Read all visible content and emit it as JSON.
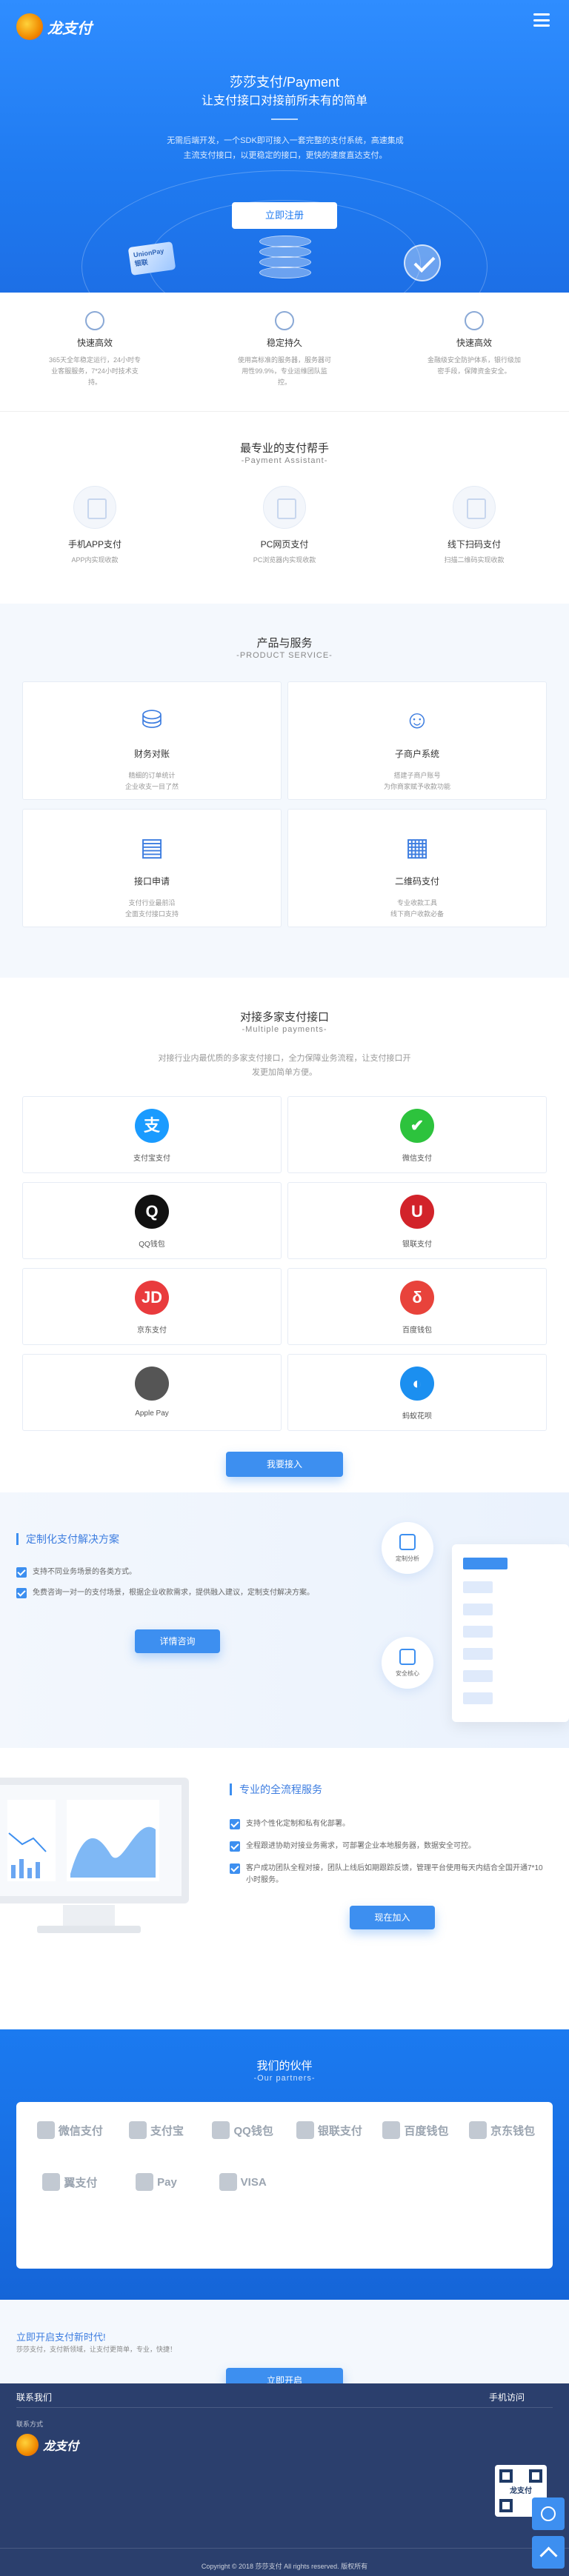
{
  "header": {
    "logo_text": "龙支付",
    "hero_title": "莎莎支付/Payment",
    "hero_subtitle": "让支付接口对接前所未有的简单",
    "hero_desc": "无需后端开发，一个SDK即可接入一套完整的支付系统，高速集成主流支付接口，以更稳定的接口，更快的速度直达支付。",
    "register_button": "立即注册",
    "card_text": "UnionPay 银联"
  },
  "features": [
    {
      "title": "快速高效",
      "desc": "365天全年稳定运行，24小时专业客服服务，7*24小时技术支持。"
    },
    {
      "title": "稳定持久",
      "desc": "使用高标准的服务器，服务器可用性99.9%，专业运维团队监控。"
    },
    {
      "title": "快速高效",
      "desc": "金融级安全防护体系，银行级加密手段，保障资金安全。"
    }
  ],
  "assistant": {
    "title": "最专业的支付帮手",
    "subtitle": "-Payment Assistant-",
    "items": [
      {
        "title": "手机APP支付",
        "desc": "APP内实现收款"
      },
      {
        "title": "PC网页支付",
        "desc": "PC浏览器内实现收款"
      },
      {
        "title": "线下扫码支付",
        "desc": "扫描二维码实现收款"
      }
    ]
  },
  "products": {
    "title": "产品与服务",
    "subtitle": "-PRODUCT SERVICE-",
    "items": [
      {
        "title": "财务对账",
        "desc1": "精细的订单统计",
        "desc2": "企业收支一目了然"
      },
      {
        "title": "子商户系统",
        "desc1": "搭建子商户账号",
        "desc2": "为你商家赋予收款功能"
      },
      {
        "title": "接口申请",
        "desc1": "支付行业最前沿",
        "desc2": "全面支付接口支持"
      },
      {
        "title": "二维码支付",
        "desc1": "专业收款工具",
        "desc2": "线下商户收款必备"
      }
    ]
  },
  "payments": {
    "title": "对接多家支付接口",
    "subtitle": "-Multiple payments-",
    "desc": "对接行业内最优质的多家支付接口，全力保障业务流程，让支付接口开发更加简单方便。",
    "items": [
      {
        "label": "支付宝支付",
        "glyph": "支",
        "color": "#1a9bff"
      },
      {
        "label": "微信支付",
        "glyph": "✔",
        "color": "#2dc33d"
      },
      {
        "label": "QQ钱包",
        "glyph": "Q",
        "color": "#111111"
      },
      {
        "label": "银联支付",
        "glyph": "U",
        "color": "#d2232a"
      },
      {
        "label": "京东支付",
        "glyph": "JD",
        "color": "#e93b3d"
      },
      {
        "label": "百度钱包",
        "glyph": "δ",
        "color": "#e8433b"
      },
      {
        "label": "Apple Pay",
        "glyph": "",
        "color": "#555555"
      },
      {
        "label": "蚂蚁花呗",
        "glyph": "◐",
        "color": "#1b8ff0"
      }
    ],
    "button": "我要接入"
  },
  "custom": {
    "title": "定制化支付解决方案",
    "checks": [
      "支持不同业务场景的各类方式。",
      "免费咨询一对一的支付场景，根据企业收款需求，提供融入建议，定制支付解决方案。"
    ],
    "button": "详情咨询",
    "badge1": "定制分析",
    "badge2": "安全核心"
  },
  "service": {
    "title": "专业的全流程服务",
    "checks": [
      "支持个性化定制和私有化部署。",
      "全程跟进协助对接业务需求，可部署企业本地服务器，数据安全可控。",
      "客户成功团队全程对接，团队上线后如期跟踪反馈，管理平台使用每天内结合全国开通7*10小时服务。"
    ],
    "button": "现在加入"
  },
  "partners": {
    "title": "我们的伙伴",
    "subtitle": "-Our partners-",
    "logos": [
      "微信支付",
      "支付宝",
      "QQ钱包",
      "银联支付",
      "百度钱包",
      "京东钱包",
      "翼支付",
      "Pay",
      "VISA"
    ]
  },
  "cta": {
    "title": "立即开启支付新时代!",
    "desc": "莎莎支付，支付新领域，让支付更简单，专业，快捷！",
    "button": "立即开启"
  },
  "footer": {
    "left_title": "联系我们",
    "right_title": "手机访问",
    "contact_label": "联系方式",
    "qr_caption": "龙支付",
    "copyright": "Copyright © 2018 莎莎支付 All rights reserved. 版权所有"
  }
}
